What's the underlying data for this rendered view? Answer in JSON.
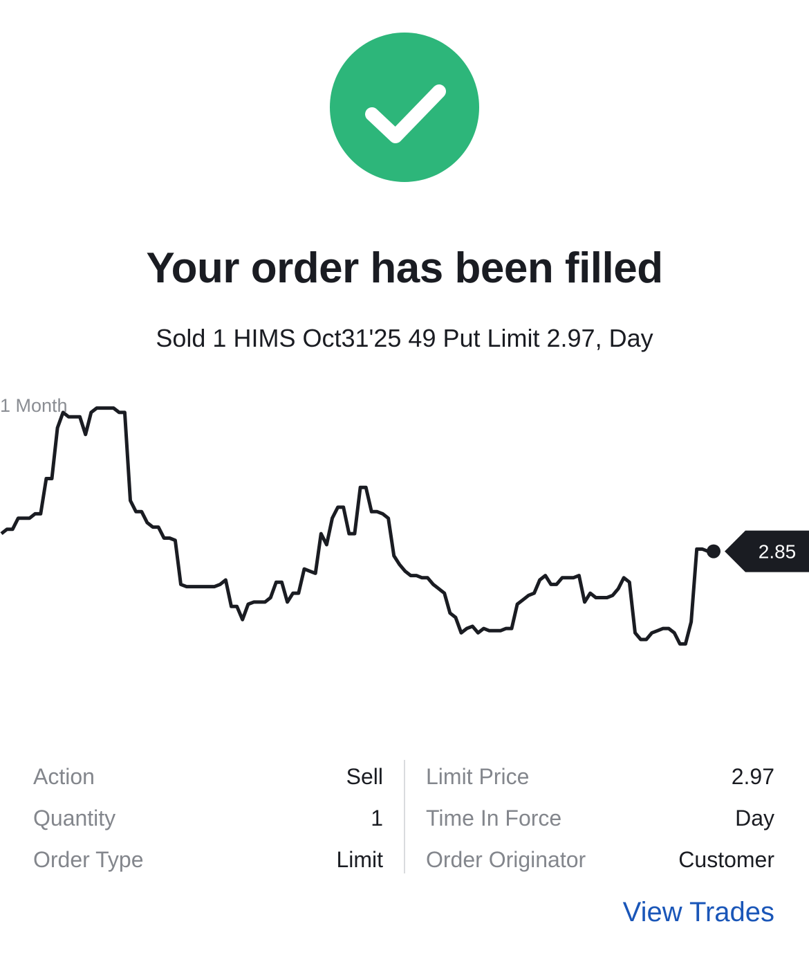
{
  "status_icon": "check-circle-icon",
  "accent_color": "#2db67a",
  "title": "Your order has been filled",
  "subtitle": "Sold 1 HIMS Oct31'25 49 Put Limit 2.97, Day",
  "chart_data": {
    "type": "line",
    "period_label": "1 Month",
    "last_value_label": "2.85",
    "line_color": "#1a1c22",
    "ylim": [
      2.3,
      3.65
    ],
    "values": [
      3.05,
      3.07,
      3.07,
      3.12,
      3.12,
      3.12,
      3.14,
      3.14,
      3.3,
      3.3,
      3.53,
      3.6,
      3.58,
      3.58,
      3.58,
      3.5,
      3.6,
      3.62,
      3.62,
      3.62,
      3.62,
      3.6,
      3.6,
      3.2,
      3.15,
      3.15,
      3.1,
      3.08,
      3.08,
      3.03,
      3.03,
      3.02,
      2.82,
      2.81,
      2.81,
      2.81,
      2.81,
      2.81,
      2.81,
      2.82,
      2.84,
      2.72,
      2.72,
      2.66,
      2.73,
      2.74,
      2.74,
      2.74,
      2.76,
      2.83,
      2.83,
      2.74,
      2.78,
      2.78,
      2.89,
      2.88,
      2.87,
      3.05,
      3.0,
      3.12,
      3.17,
      3.17,
      3.05,
      3.05,
      3.26,
      3.26,
      3.15,
      3.15,
      3.14,
      3.12,
      2.95,
      2.91,
      2.88,
      2.86,
      2.86,
      2.85,
      2.85,
      2.82,
      2.8,
      2.78,
      2.69,
      2.67,
      2.6,
      2.62,
      2.63,
      2.6,
      2.62,
      2.61,
      2.61,
      2.61,
      2.62,
      2.62,
      2.73,
      2.75,
      2.77,
      2.78,
      2.84,
      2.86,
      2.82,
      2.82,
      2.85,
      2.85,
      2.85,
      2.86,
      2.74,
      2.78,
      2.76,
      2.76,
      2.76,
      2.77,
      2.8,
      2.85,
      2.83,
      2.6,
      2.57,
      2.57,
      2.6,
      2.61,
      2.62,
      2.62,
      2.6,
      2.55,
      2.55,
      2.65,
      2.98,
      2.98,
      2.97,
      2.97
    ]
  },
  "details": {
    "left": [
      {
        "label": "Action",
        "value": "Sell"
      },
      {
        "label": "Quantity",
        "value": "1"
      },
      {
        "label": "Order Type",
        "value": "Limit"
      }
    ],
    "right": [
      {
        "label": "Limit Price",
        "value": "2.97"
      },
      {
        "label": "Time In Force",
        "value": "Day"
      },
      {
        "label": "Order Originator",
        "value": "Customer"
      }
    ]
  },
  "view_trades_label": "View Trades",
  "link_color": "#1a56b8"
}
